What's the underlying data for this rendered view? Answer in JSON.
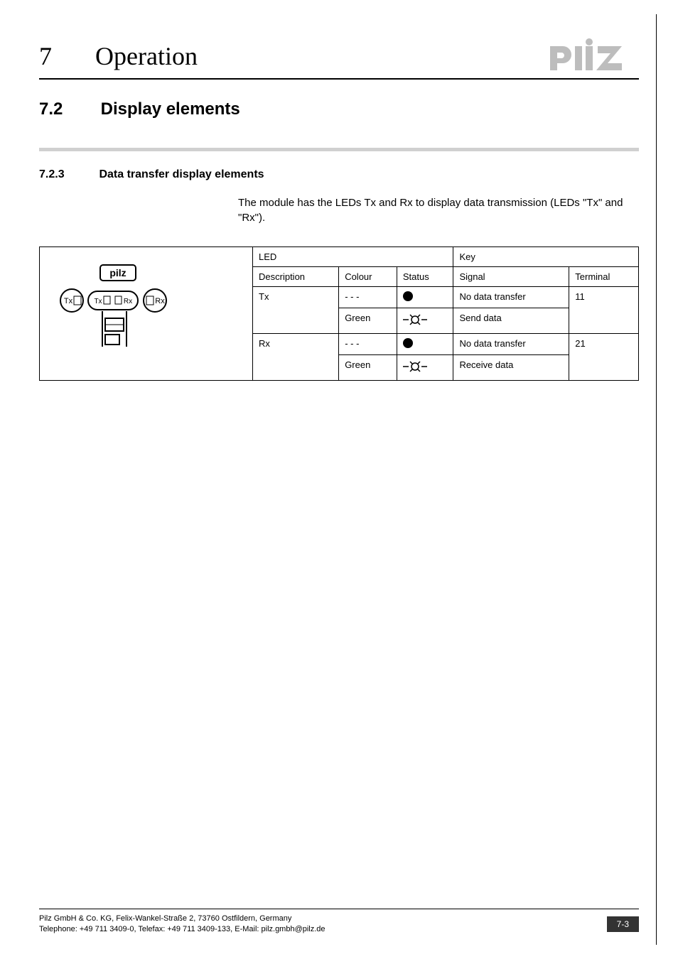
{
  "header": {
    "chapter_number": "7",
    "chapter_title": "Operation",
    "logo_alt": "pilz"
  },
  "section": {
    "number": "7.2",
    "title": "Display elements"
  },
  "subsection": {
    "number": "7.2.3",
    "title": "Data transfer display elements"
  },
  "intro_text": "The module has the LEDs Tx and Rx to display data transmission (LEDs \"Tx\" and \"Rx\").",
  "table": {
    "group_header_led": "LED",
    "group_header_key": "Key",
    "col_description": "Description",
    "col_colour": "Colour",
    "col_status": "Status",
    "col_signal": "Signal",
    "col_terminal": "Terminal",
    "rows": [
      {
        "description": "Tx",
        "colour": "- - -",
        "status_type": "off",
        "signal": "No data transfer",
        "terminal": "11"
      },
      {
        "description": "",
        "colour": "Green",
        "status_type": "flash",
        "signal": "Send data",
        "terminal": ""
      },
      {
        "description": "Rx",
        "colour": "- - -",
        "status_type": "off",
        "signal": "No data transfer",
        "terminal": "21"
      },
      {
        "description": "",
        "colour": "Green",
        "status_type": "flash",
        "signal": "Receive data",
        "terminal": ""
      }
    ],
    "diagram": {
      "brand": "pilz",
      "left_label": "Tx",
      "mid_left": "Tx",
      "mid_right": "Rx",
      "right_label": "Rx"
    }
  },
  "footer": {
    "line1": "Pilz GmbH & Co. KG, Felix-Wankel-Straße 2, 73760 Ostfildern, Germany",
    "line2": "Telephone: +49 711 3409-0, Telefax: +49 711 3409-133, E-Mail: pilz.gmbh@pilz.de",
    "page_number": "7-3"
  }
}
